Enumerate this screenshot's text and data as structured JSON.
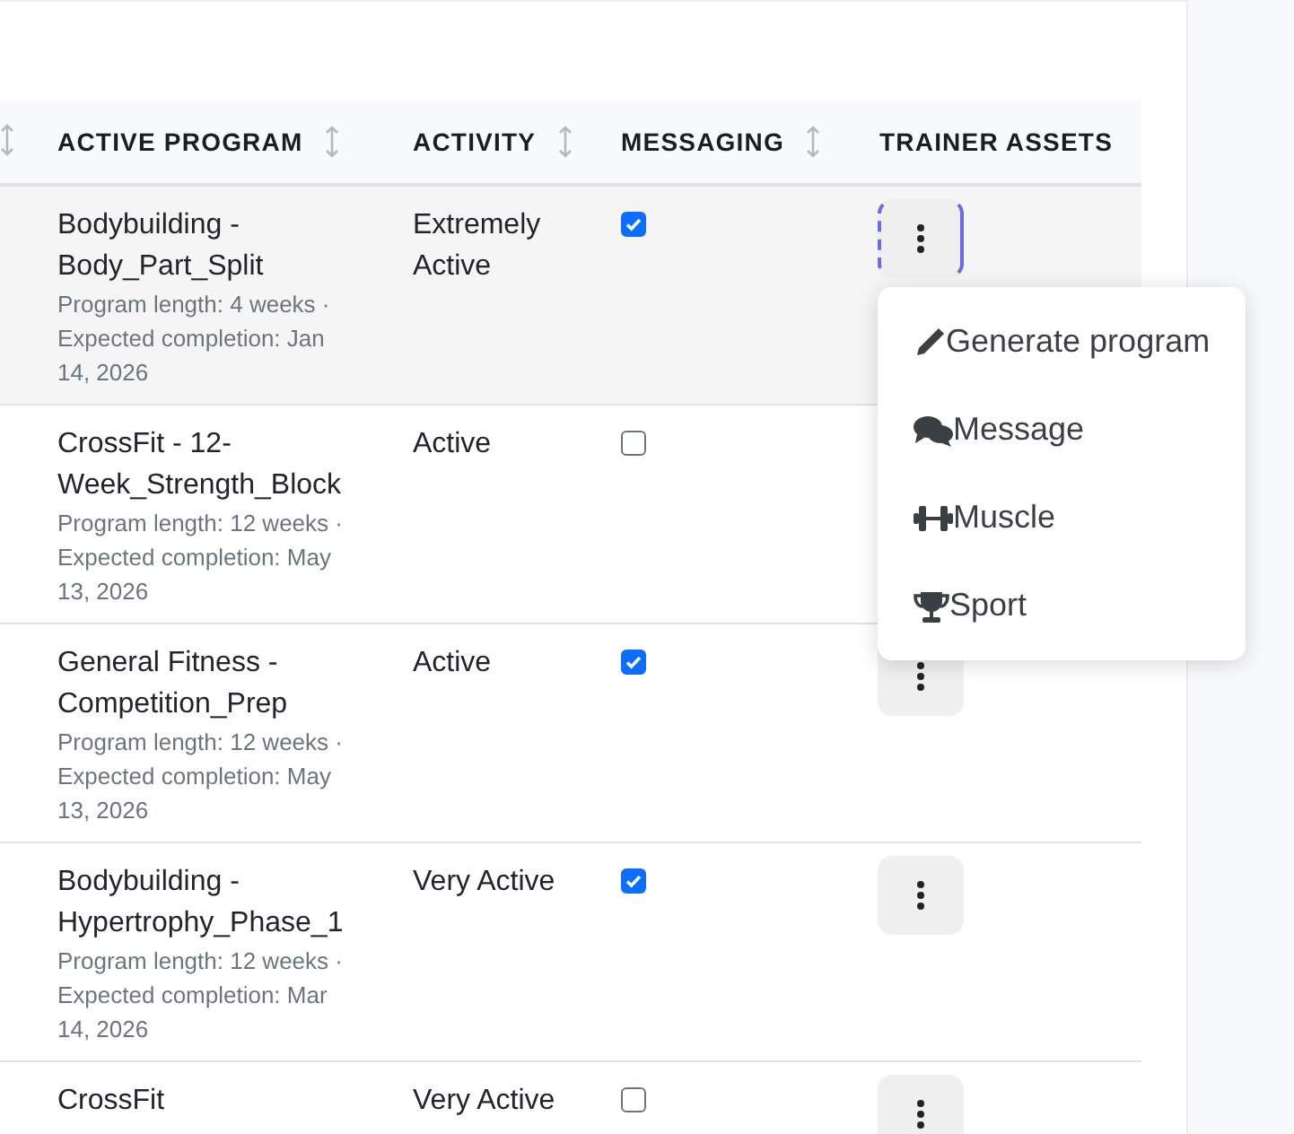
{
  "table": {
    "columns": [
      {
        "sortable": true
      },
      {
        "label": "ACTIVE PROGRAM",
        "sortable": true
      },
      {
        "label": "ACTIVITY",
        "sortable": true
      },
      {
        "label": "MESSAGING",
        "sortable": true
      },
      {
        "label": "TRAINER ASSETS",
        "sortable": false
      }
    ],
    "rows": [
      {
        "program": "Bodybuilding - Body_Part_Split",
        "details": "Program length: 4 weeks · Expected completion: Jan 14, 2026",
        "activity": "Extremely Active",
        "messaging": true,
        "menu_open": true
      },
      {
        "program": "CrossFit - 12-Week_Strength_Block",
        "details": "Program length: 12 weeks · Expected completion: May 13, 2026",
        "activity": "Active",
        "messaging": false,
        "menu_open": false
      },
      {
        "program": "General Fitness - Competition_Prep",
        "details": "Program length: 12 weeks · Expected completion: May 13, 2026",
        "activity": "Active",
        "messaging": true,
        "menu_open": false
      },
      {
        "program": "Bodybuilding - Hypertrophy_Phase_1",
        "details": "Program length: 12 weeks · Expected completion: Mar 14, 2026",
        "activity": "Very Active",
        "messaging": true,
        "menu_open": false
      },
      {
        "program": "CrossFit",
        "activity": "Very Active",
        "messaging": false,
        "menu_open": false
      }
    ]
  },
  "menu": {
    "items": [
      {
        "kind": "pencil",
        "label": "Generate program"
      },
      {
        "kind": "comments",
        "label": "Message"
      },
      {
        "kind": "dumbbell",
        "label": "Muscle"
      },
      {
        "kind": "trophy",
        "label": "Sport"
      }
    ]
  }
}
